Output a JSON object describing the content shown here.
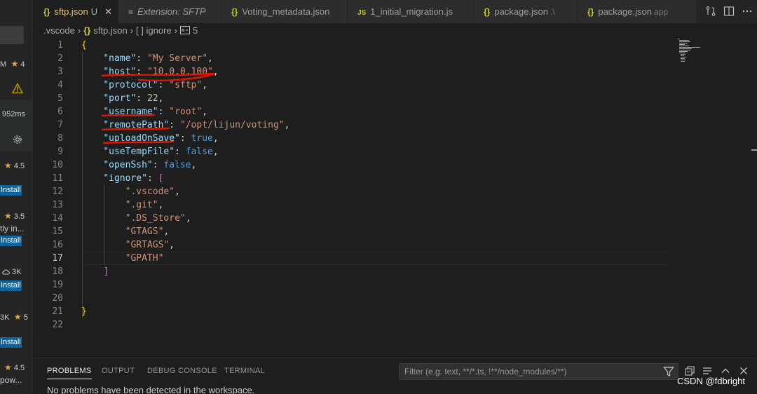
{
  "sidebar": {
    "items": [
      {
        "text": "M",
        "rating": "4"
      },
      {
        "text": "952ms"
      },
      {
        "rating": "4.5",
        "install": "Install"
      },
      {
        "rating": "3.5",
        "desc": "tly in...",
        "install": "Install"
      },
      {
        "downloads": "3K",
        "install": "Install"
      },
      {
        "text": "3K",
        "rating": "5",
        "install": "Install"
      },
      {
        "rating": "4.5",
        "desc": "pow..."
      }
    ]
  },
  "tabs": [
    {
      "label": "sftp.json",
      "badge": "U",
      "icon": "json-braces-icon",
      "active": true
    },
    {
      "label": "Extension: SFTP",
      "icon": "extension-icon"
    },
    {
      "label": "Voting_metadata.json",
      "icon": "json-braces-icon"
    },
    {
      "label": "1_initial_migration.js",
      "icon": "js-icon"
    },
    {
      "label": "package.json",
      "suffix": ".\\",
      "icon": "json-braces-icon"
    },
    {
      "label": "package.json",
      "suffix": "app",
      "icon": "json-braces-icon"
    }
  ],
  "breadcrumb": {
    "folder": ".vscode",
    "file": "sftp.json",
    "array_symbol": "[ ]",
    "key": "ignore",
    "item_index": "5"
  },
  "editor": {
    "line_numbers": [
      "1",
      "2",
      "3",
      "4",
      "5",
      "6",
      "7",
      "8",
      "9",
      "10",
      "11",
      "12",
      "13",
      "14",
      "15",
      "16",
      "17",
      "18",
      "19",
      "20",
      "21",
      "22"
    ],
    "current_line": "17",
    "config": {
      "name": "\"My Server\"",
      "host": "\"10.0.0.100\"",
      "protocol": "\"sftp\"",
      "port": "22",
      "username": "\"root\"",
      "remotePath": "\"/opt/lijun/voting\"",
      "uploadOnSave": "true",
      "useTempFile": "false",
      "openSsh": "false",
      "ignore": [
        "\".vscode\"",
        "\".git\"",
        "\".DS_Store\"",
        "\"GTAGS\"",
        "\"GRTAGS\"",
        "\"GPATH\""
      ]
    },
    "keys": {
      "name": "\"name\"",
      "host": "\"host\"",
      "protocol": "\"protocol\"",
      "port": "\"port\"",
      "username": "\"username\"",
      "remotePath": "\"remotePath\"",
      "uploadOnSave": "\"uploadOnSave\"",
      "useTempFile": "\"useTempFile\"",
      "openSsh": "\"openSsh\"",
      "ignore": "\"ignore\""
    }
  },
  "panel": {
    "tabs": [
      "PROBLEMS",
      "OUTPUT",
      "DEBUG CONSOLE",
      "TERMINAL"
    ],
    "active_tab": "PROBLEMS",
    "filter_placeholder": "Filter (e.g. text, **/*.ts, !**/node_modules/**)",
    "message": "No problems have been detected in the workspace."
  },
  "watermark": "CSDN @fdbright",
  "colors": {
    "accent_blue": "#0e639c",
    "star": "#e8a73b",
    "annotation_red": "#e51400",
    "json_key": "#9cdcfe",
    "json_string": "#ce9178"
  }
}
